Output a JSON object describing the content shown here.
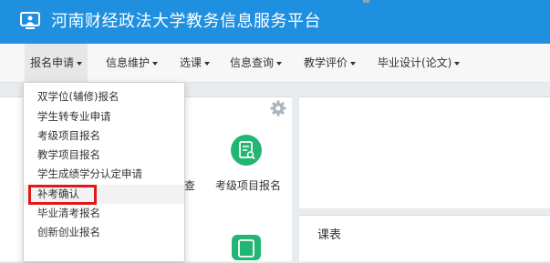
{
  "header": {
    "title": "河南财经政法大学教务信息服务平台",
    "logo_icon": "monitor-user-icon",
    "background": "#1f8fe0"
  },
  "navbar": {
    "items": [
      {
        "label": "报名申请",
        "active": true
      },
      {
        "label": "信息维护"
      },
      {
        "label": "选课"
      },
      {
        "label": "信息查询"
      },
      {
        "label": "教学评价"
      },
      {
        "label": "毕业设计(论文)"
      }
    ]
  },
  "dropdown": {
    "items": [
      {
        "label": "双学位(辅修)报名"
      },
      {
        "label": "学生转专业申请"
      },
      {
        "label": "考级项目报名"
      },
      {
        "label": "教学项目报名"
      },
      {
        "label": "学生成绩学分认定申请"
      },
      {
        "label": "补考确认",
        "highlighted": true
      },
      {
        "label": "毕业清考报名"
      },
      {
        "label": "创新创业报名"
      }
    ],
    "highlight_color": "#e01818"
  },
  "apps": {
    "partial_label": "查",
    "exam_label": "考级项目报名",
    "icon_color": "#22b573"
  },
  "schedule_panel": {
    "title": "课表"
  },
  "settings_icon": "gear-icon"
}
